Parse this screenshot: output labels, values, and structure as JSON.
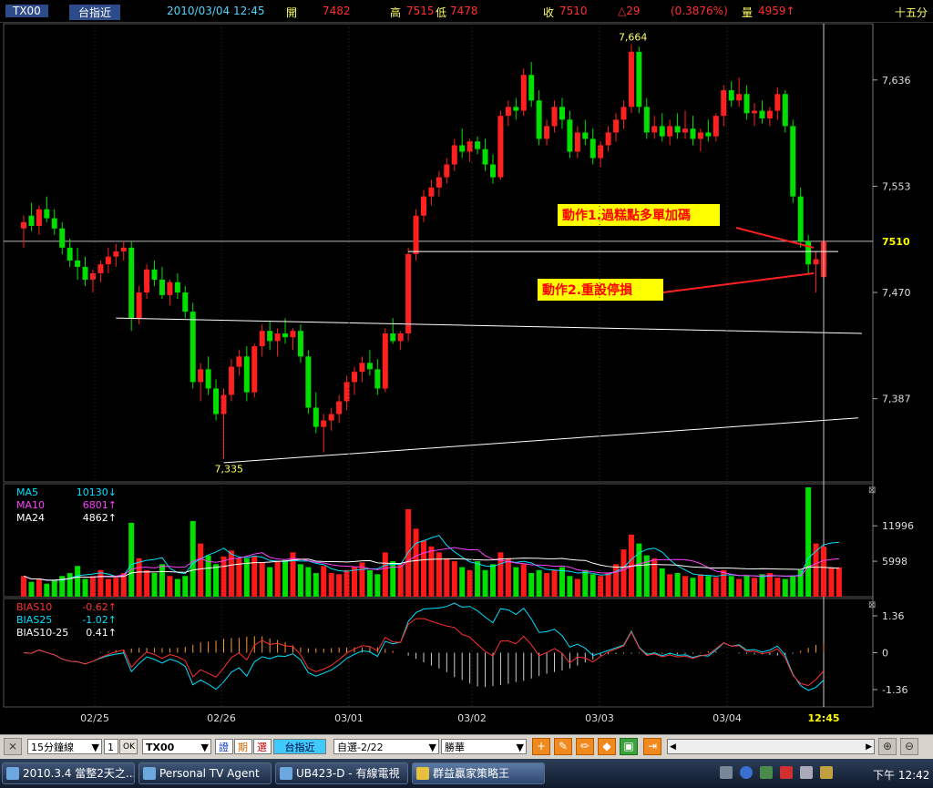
{
  "header": {
    "symbol": "TX00",
    "name": "台指近",
    "datetime": "2010/03/04 12:45",
    "open_label": "開",
    "open": "7482",
    "high_label": "高",
    "high": "7515",
    "low_label": "低",
    "low": "7478",
    "close_label": "收",
    "close": "7510",
    "change": "△29",
    "change_pct": "(0.3876%)",
    "volume_label": "量",
    "volume": "4959↑",
    "period": "十五分"
  },
  "annotations": {
    "action1": "動作1.過糕點多單加碼",
    "action2": "動作2.重設停損",
    "high_label": "7,664",
    "low_label": "7,335",
    "current_price_label": "7510"
  },
  "chart_data": [
    {
      "type": "candlestick",
      "title": "",
      "y_ticks": [
        "7,636",
        "7,553",
        "7,470",
        "7,387"
      ],
      "y_tick_values": [
        7636,
        7553,
        7470,
        7387
      ],
      "ylim": [
        7322,
        7680
      ],
      "x_ticks": [
        "02/25",
        "02/26",
        "03/01",
        "03/02",
        "03/03",
        "03/04",
        "12:45"
      ],
      "current_price": 7510,
      "high": 7664,
      "low": 7335,
      "ohlc": [
        [
          7520,
          7530,
          7505,
          7525
        ],
        [
          7530,
          7540,
          7518,
          7522
        ],
        [
          7522,
          7538,
          7515,
          7535
        ],
        [
          7535,
          7545,
          7525,
          7528
        ],
        [
          7528,
          7535,
          7515,
          7520
        ],
        [
          7520,
          7525,
          7500,
          7505
        ],
        [
          7505,
          7512,
          7490,
          7495
        ],
        [
          7495,
          7505,
          7480,
          7490
        ],
        [
          7490,
          7498,
          7475,
          7480
        ],
        [
          7480,
          7488,
          7470,
          7485
        ],
        [
          7485,
          7495,
          7478,
          7492
        ],
        [
          7492,
          7505,
          7485,
          7498
        ],
        [
          7498,
          7508,
          7490,
          7502
        ],
        [
          7502,
          7510,
          7495,
          7505
        ],
        [
          7505,
          7510,
          7440,
          7450
        ],
        [
          7450,
          7475,
          7445,
          7470
        ],
        [
          7470,
          7492,
          7465,
          7488
        ],
        [
          7488,
          7495,
          7475,
          7480
        ],
        [
          7480,
          7490,
          7465,
          7468
        ],
        [
          7468,
          7480,
          7460,
          7478
        ],
        [
          7478,
          7485,
          7465,
          7470
        ],
        [
          7470,
          7475,
          7450,
          7455
        ],
        [
          7455,
          7462,
          7395,
          7400
        ],
        [
          7400,
          7415,
          7385,
          7410
        ],
        [
          7410,
          7420,
          7390,
          7395
        ],
        [
          7395,
          7402,
          7370,
          7375
        ],
        [
          7375,
          7395,
          7340,
          7390
        ],
        [
          7390,
          7418,
          7385,
          7412
        ],
        [
          7412,
          7425,
          7405,
          7420
        ],
        [
          7420,
          7428,
          7385,
          7392
        ],
        [
          7392,
          7430,
          7388,
          7428
        ],
        [
          7428,
          7445,
          7420,
          7440
        ],
        [
          7440,
          7448,
          7425,
          7432
        ],
        [
          7432,
          7442,
          7420,
          7438
        ],
        [
          7438,
          7450,
          7430,
          7435
        ],
        [
          7435,
          7442,
          7425,
          7440
        ],
        [
          7440,
          7445,
          7415,
          7420
        ],
        [
          7420,
          7425,
          7375,
          7380
        ],
        [
          7380,
          7392,
          7360,
          7365
        ],
        [
          7365,
          7375,
          7345,
          7370
        ],
        [
          7370,
          7380,
          7362,
          7375
        ],
        [
          7375,
          7390,
          7368,
          7385
        ],
        [
          7385,
          7405,
          7378,
          7400
        ],
        [
          7400,
          7412,
          7390,
          7408
        ],
        [
          7408,
          7420,
          7400,
          7415
        ],
        [
          7415,
          7425,
          7405,
          7410
        ],
        [
          7410,
          7418,
          7390,
          7395
        ],
        [
          7395,
          7442,
          7392,
          7438
        ],
        [
          7438,
          7450,
          7430,
          7432
        ],
        [
          7432,
          7440,
          7425,
          7438
        ],
        [
          7438,
          7505,
          7432,
          7500
        ],
        [
          7500,
          7535,
          7495,
          7530
        ],
        [
          7530,
          7550,
          7525,
          7545
        ],
        [
          7545,
          7558,
          7538,
          7552
        ],
        [
          7552,
          7565,
          7545,
          7560
        ],
        [
          7560,
          7575,
          7555,
          7570
        ],
        [
          7570,
          7590,
          7565,
          7585
        ],
        [
          7585,
          7598,
          7575,
          7580
        ],
        [
          7580,
          7590,
          7572,
          7588
        ],
        [
          7588,
          7592,
          7578,
          7582
        ],
        [
          7582,
          7590,
          7565,
          7570
        ],
        [
          7570,
          7578,
          7555,
          7560
        ],
        [
          7560,
          7612,
          7558,
          7608
        ],
        [
          7608,
          7620,
          7600,
          7615
        ],
        [
          7615,
          7622,
          7605,
          7612
        ],
        [
          7612,
          7645,
          7608,
          7640
        ],
        [
          7640,
          7650,
          7615,
          7620
        ],
        [
          7620,
          7628,
          7585,
          7590
        ],
        [
          7590,
          7605,
          7585,
          7600
        ],
        [
          7600,
          7620,
          7595,
          7615
        ],
        [
          7615,
          7622,
          7598,
          7605
        ],
        [
          7605,
          7612,
          7575,
          7580
        ],
        [
          7580,
          7600,
          7575,
          7595
        ],
        [
          7595,
          7605,
          7585,
          7590
        ],
        [
          7590,
          7598,
          7570,
          7575
        ],
        [
          7575,
          7588,
          7568,
          7585
        ],
        [
          7585,
          7600,
          7580,
          7595
        ],
        [
          7595,
          7610,
          7588,
          7605
        ],
        [
          7605,
          7620,
          7598,
          7615
        ],
        [
          7615,
          7664,
          7610,
          7658
        ],
        [
          7658,
          7662,
          7610,
          7615
        ],
        [
          7615,
          7622,
          7590,
          7595
        ],
        [
          7595,
          7608,
          7590,
          7600
        ],
        [
          7600,
          7610,
          7588,
          7592
        ],
        [
          7592,
          7605,
          7585,
          7600
        ],
        [
          7600,
          7610,
          7590,
          7595
        ],
        [
          7595,
          7612,
          7590,
          7598
        ],
        [
          7598,
          7608,
          7585,
          7590
        ],
        [
          7590,
          7598,
          7580,
          7595
        ],
        [
          7595,
          7605,
          7588,
          7592
        ],
        [
          7592,
          7610,
          7588,
          7608
        ],
        [
          7608,
          7632,
          7600,
          7628
        ],
        [
          7628,
          7635,
          7615,
          7620
        ],
        [
          7620,
          7638,
          7615,
          7625
        ],
        [
          7625,
          7632,
          7605,
          7610
        ],
        [
          7610,
          7618,
          7600,
          7612
        ],
        [
          7612,
          7620,
          7602,
          7606
        ],
        [
          7606,
          7615,
          7600,
          7612
        ],
        [
          7612,
          7630,
          7605,
          7625
        ],
        [
          7625,
          7628,
          7595,
          7600
        ],
        [
          7600,
          7605,
          7540,
          7545
        ],
        [
          7545,
          7552,
          7505,
          7510
        ],
        [
          7510,
          7515,
          7485,
          7492
        ],
        [
          7492,
          7502,
          7470,
          7496
        ],
        [
          7482,
          7515,
          7478,
          7510
        ]
      ]
    },
    {
      "type": "bar",
      "title": "",
      "legend": [
        {
          "name": "MA5",
          "value": "10130↓",
          "color": "#00e0ff"
        },
        {
          "name": "MA10",
          "value": "6801↑",
          "color": "#ff40ff"
        },
        {
          "name": "MA24",
          "value": "4862↑",
          "color": "#ffffff"
        }
      ],
      "y_ticks": [
        "11996",
        "5998"
      ],
      "y_tick_values": [
        11996,
        5998
      ],
      "ylim": [
        0,
        18500
      ],
      "values": [
        3500,
        2500,
        3000,
        2200,
        2800,
        3500,
        4000,
        5200,
        3000,
        3500,
        4500,
        3000,
        3200,
        4000,
        12500,
        6500,
        4500,
        4000,
        5500,
        3500,
        3000,
        3500,
        12800,
        9000,
        7000,
        5500,
        6800,
        7800,
        6500,
        6500,
        6800,
        5800,
        5000,
        6000,
        6200,
        7500,
        5500,
        5000,
        4000,
        5200,
        4000,
        3800,
        4500,
        5000,
        5800,
        4500,
        3800,
        7500,
        6000,
        5500,
        14800,
        11500,
        9500,
        8500,
        7500,
        6500,
        6000,
        5000,
        4500,
        6000,
        4500,
        5500,
        7500,
        6500,
        5000,
        5500,
        4000,
        4500,
        4000,
        4500,
        5000,
        3500,
        3000,
        4500,
        3800,
        3500,
        4000,
        5500,
        8000,
        10500,
        9000,
        7000,
        6500,
        4800,
        3800,
        4000,
        3500,
        3200,
        3800,
        3500,
        3300,
        4500,
        3500,
        3000,
        3500,
        3200,
        3800,
        4000,
        3200,
        3000,
        3500,
        4500,
        18500,
        9000,
        8500,
        5000,
        4959
      ],
      "ma5_line": true,
      "ma10_line": true,
      "ma24_line": true
    },
    {
      "type": "line",
      "title": "",
      "legend": [
        {
          "name": "BIAS10",
          "value": "-0.62↑",
          "color": "#ff3030"
        },
        {
          "name": "BIAS25",
          "value": "-1.02↑",
          "color": "#00e0ff"
        },
        {
          "name": "BIAS10-25",
          "value": "0.41↑",
          "color": "#ffffff"
        }
      ],
      "y_ticks": [
        "1.36",
        "0",
        "-1.36"
      ],
      "y_tick_values": [
        1.36,
        0,
        -1.36
      ],
      "ylim": [
        -2.0,
        2.0
      ]
    }
  ],
  "toolbar": {
    "period_select": "15分鐘線",
    "count": "1",
    "ok": "OK",
    "symbol": "TX00",
    "btn1": "證",
    "btn2": "期",
    "btn3": "選",
    "name_btn": "台指近",
    "group_select": "自選-2/22",
    "broker_select": "勝華"
  },
  "taskbar": {
    "items": [
      "2010.3.4 當整2天之...",
      "Personal TV Agent",
      "UB423-D - 有線電視",
      "群益贏家策略王"
    ],
    "clock": "下午 12:42"
  }
}
